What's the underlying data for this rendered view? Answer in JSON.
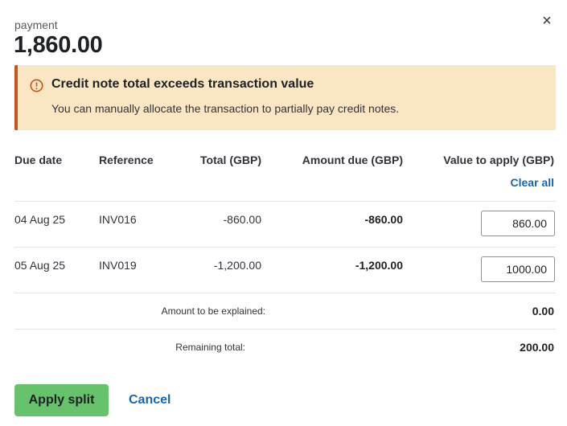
{
  "header": {
    "kind": "payment",
    "amount": "1,860.00",
    "close_symbol": "×"
  },
  "alert": {
    "icon": "warning-circle-icon",
    "title": "Credit note total exceeds transaction value",
    "message": "You can manually allocate the transaction to partially pay credit notes.",
    "accent_color": "#c9541a",
    "background_color": "#fbe6c4"
  },
  "table": {
    "columns": {
      "due_date": "Due date",
      "reference": "Reference",
      "total": "Total (GBP)",
      "amount_due": "Amount due (GBP)",
      "value_to_apply": "Value to apply (GBP)"
    },
    "clear_all": "Clear all",
    "rows": [
      {
        "due_date": "04 Aug 25",
        "reference": "INV016",
        "total": "-860.00",
        "amount_due": "-860.00",
        "value_to_apply": "860.00"
      },
      {
        "due_date": "05 Aug 25",
        "reference": "INV019",
        "total": "-1,200.00",
        "amount_due": "-1,200.00",
        "value_to_apply": "1000.00"
      }
    ]
  },
  "summary": {
    "to_explain_label": "Amount to be explained:",
    "to_explain_value": "0.00",
    "remaining_label": "Remaining total:",
    "remaining_value": "200.00"
  },
  "actions": {
    "apply_label": "Apply split",
    "cancel_label": "Cancel",
    "primary_color": "#66c36c",
    "link_color": "#1167b8"
  }
}
